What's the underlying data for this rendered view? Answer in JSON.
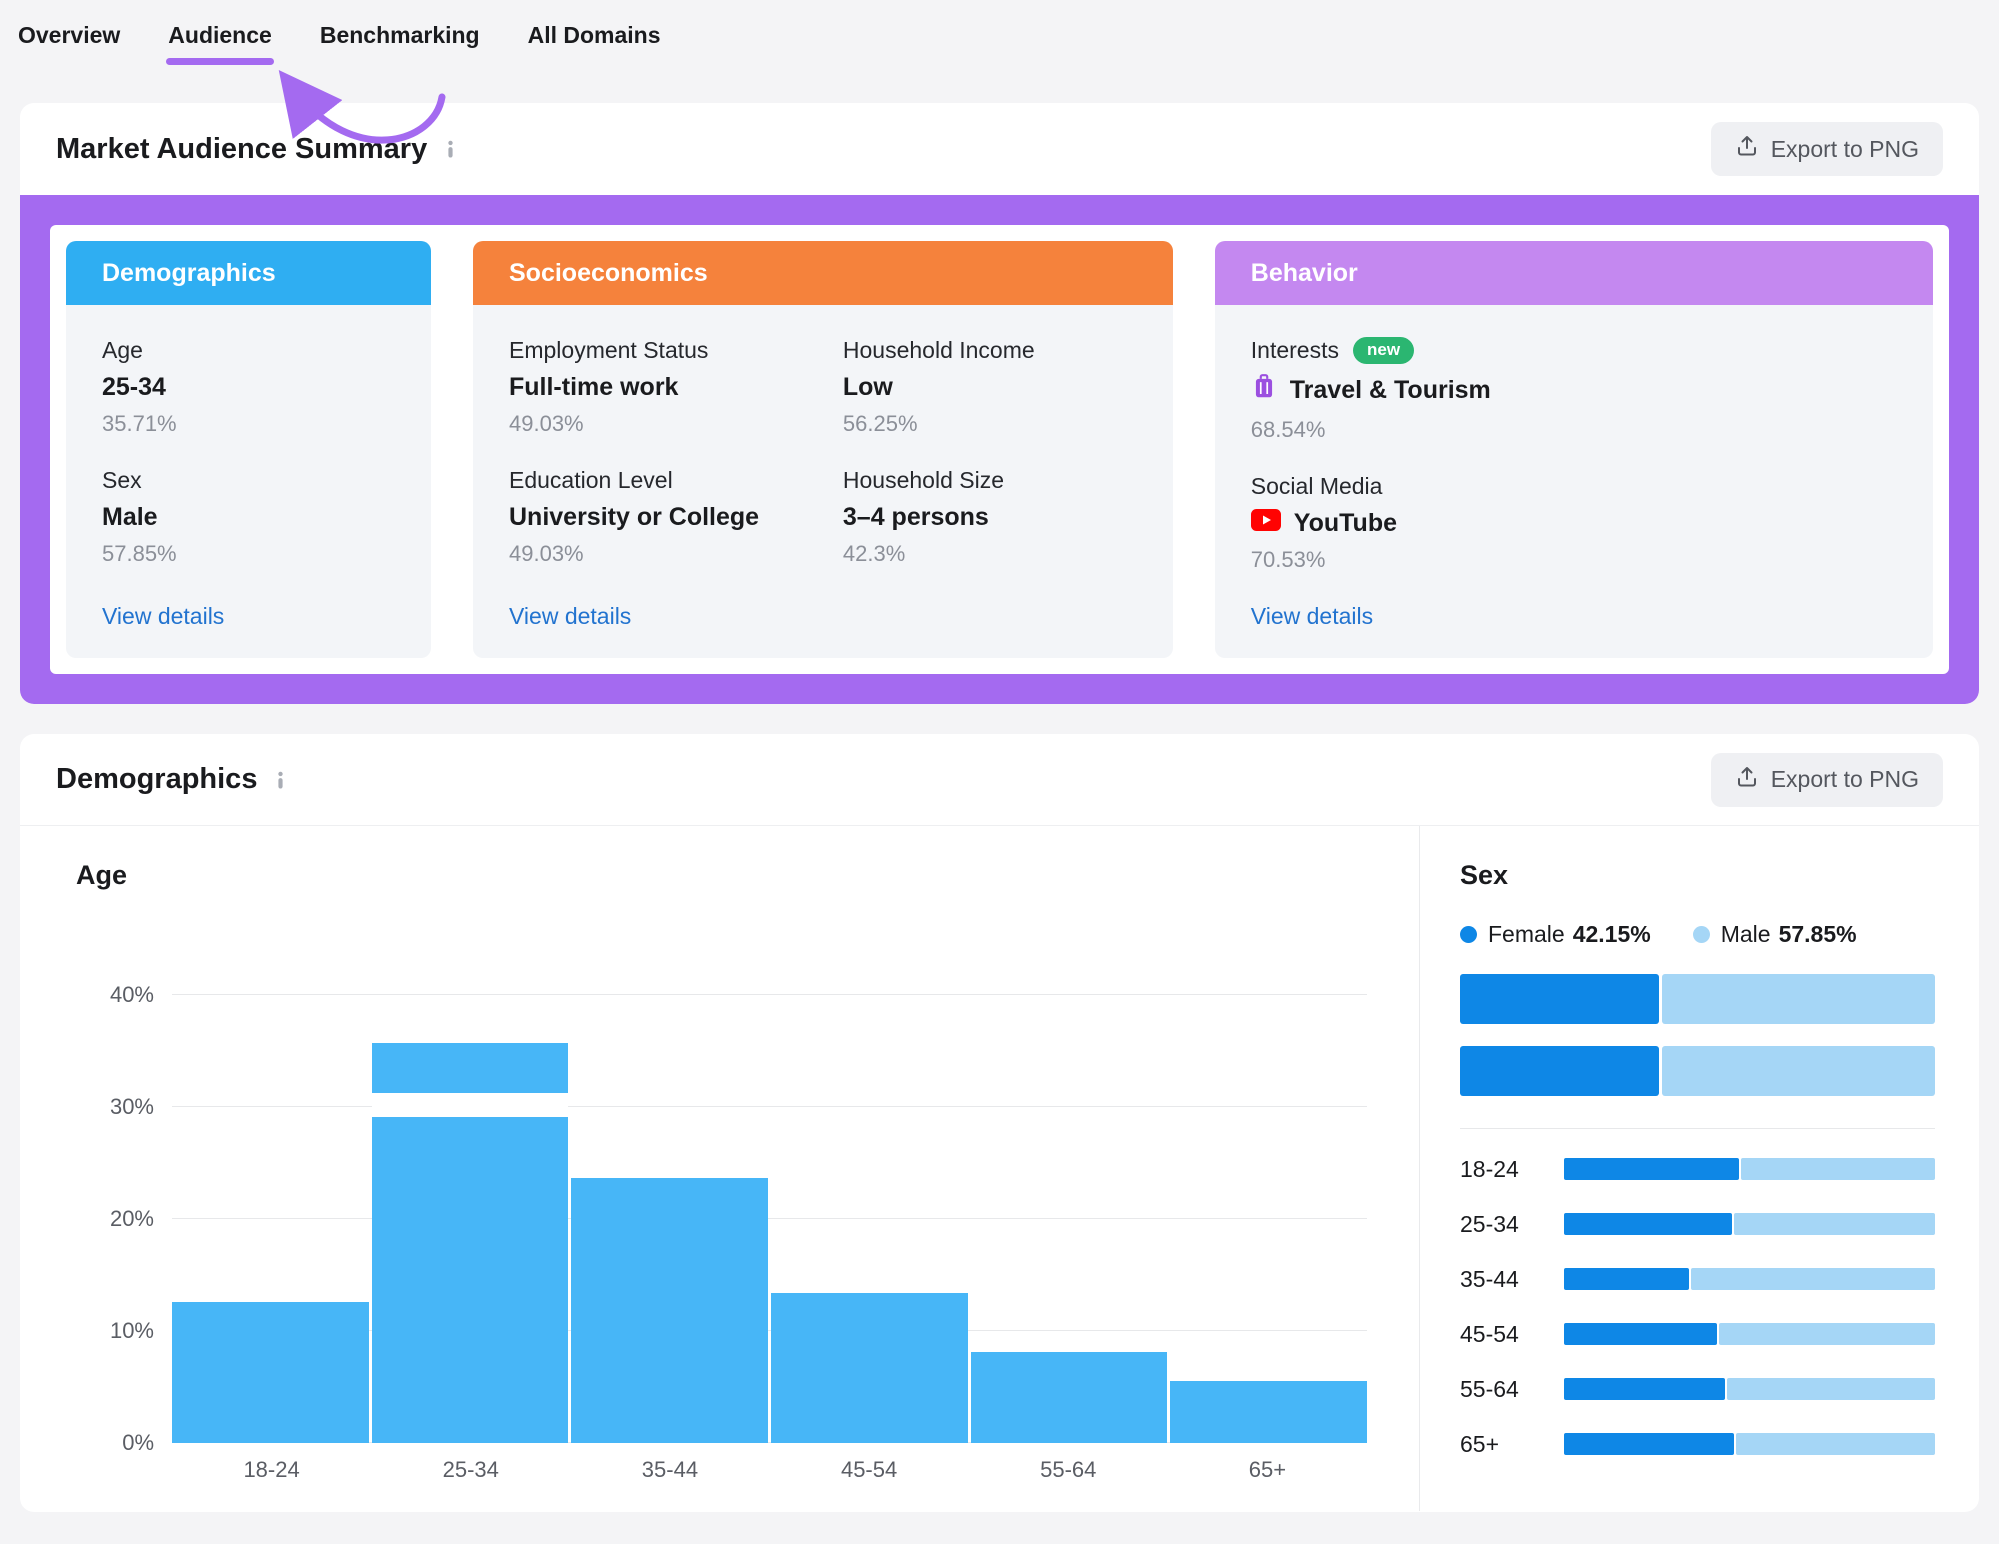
{
  "nav": {
    "items": [
      {
        "label": "Overview"
      },
      {
        "label": "Audience"
      },
      {
        "label": "Benchmarking"
      },
      {
        "label": "All Domains"
      }
    ],
    "active": "Audience"
  },
  "summary": {
    "title": "Market Audience Summary",
    "export_label": "Export to PNG",
    "accent_colors": {
      "demographics": "#2FAEF2",
      "socioeconomics": "#F5823C",
      "behavior": "#C488F0",
      "frame": "#A46AF0"
    },
    "cards": {
      "demographics": {
        "title": "Demographics",
        "items": [
          {
            "label": "Age",
            "value": "25-34",
            "percent": "35.71%"
          },
          {
            "label": "Sex",
            "value": "Male",
            "percent": "57.85%"
          }
        ],
        "link": "View details"
      },
      "socioeconomics": {
        "title": "Socioeconomics",
        "items": [
          {
            "label": "Employment Status",
            "value": "Full-time work",
            "percent": "49.03%"
          },
          {
            "label": "Household Income",
            "value": "Low",
            "percent": "56.25%"
          },
          {
            "label": "Education Level",
            "value": "University or College",
            "percent": "49.03%"
          },
          {
            "label": "Household Size",
            "value": "3–4 persons",
            "percent": "42.3%"
          }
        ],
        "link": "View details"
      },
      "behavior": {
        "title": "Behavior",
        "interests": {
          "label": "Interests",
          "badge": "new",
          "icon": "luggage-icon",
          "value": "Travel & Tourism",
          "percent": "68.54%"
        },
        "social": {
          "label": "Social Media",
          "icon": "youtube-icon",
          "value": "YouTube",
          "percent": "70.53%"
        },
        "link": "View details"
      }
    }
  },
  "demographics_panel": {
    "title": "Demographics",
    "export_label": "Export to PNG"
  },
  "chart_data": [
    {
      "type": "bar",
      "title": "Age",
      "categories": [
        "18-24",
        "25-34",
        "35-44",
        "45-54",
        "55-64",
        "65+"
      ],
      "values": [
        12.6,
        35.71,
        23.7,
        13.4,
        8.1,
        5.5
      ],
      "ylim": [
        0,
        40
      ],
      "yticks": [
        {
          "v": 0,
          "label": "0%"
        },
        {
          "v": 10,
          "label": "10%"
        },
        {
          "v": 20,
          "label": "20%"
        },
        {
          "v": 30,
          "label": "30%"
        },
        {
          "v": 40,
          "label": "40%"
        }
      ],
      "grid": true,
      "bar_color": "#47B6F7",
      "split_gap": {
        "bar_index": 1,
        "top_pct": 12.5,
        "height_pct": 6
      }
    },
    {
      "type": "bar",
      "title": "Sex",
      "orientation": "horizontal-stacked",
      "legend": [
        {
          "name": "Female",
          "value": "42.15%",
          "color": "#0E87E6"
        },
        {
          "name": "Male",
          "value": "57.85%",
          "color": "#A5D6F6"
        }
      ],
      "colors": {
        "female": "#0E87E6",
        "male": "#A5D6F6"
      },
      "overall_bars": [
        42.15,
        42.15
      ],
      "rows": [
        {
          "label": "18-24",
          "female_pct": 47.5
        },
        {
          "label": "25-34",
          "female_pct": 45.5
        },
        {
          "label": "35-44",
          "female_pct": 34.0
        },
        {
          "label": "45-54",
          "female_pct": 41.5
        },
        {
          "label": "55-64",
          "female_pct": 43.5
        },
        {
          "label": "65+",
          "female_pct": 46.0
        }
      ]
    }
  ]
}
